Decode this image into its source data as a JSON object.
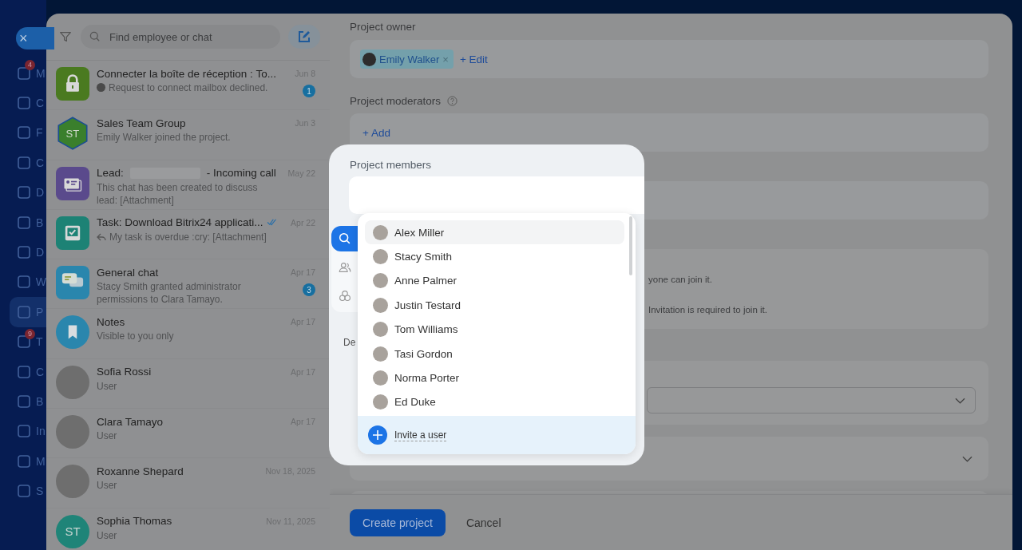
{
  "sidebar": {
    "close_label": "×",
    "items": [
      {
        "label": "M",
        "badge": "4",
        "selected": false
      },
      {
        "label": "C",
        "selected": false
      },
      {
        "label": "F",
        "selected": false
      },
      {
        "label": "C",
        "selected": false
      },
      {
        "label": "D",
        "selected": false
      },
      {
        "label": "B",
        "selected": false
      },
      {
        "label": "D",
        "selected": false
      },
      {
        "label": "W",
        "selected": false
      },
      {
        "label": "P",
        "selected": true
      },
      {
        "label": "T",
        "badge": "9",
        "selected": false
      },
      {
        "label": "C",
        "selected": false
      },
      {
        "label": "B",
        "selected": false
      },
      {
        "label": "In",
        "selected": false
      },
      {
        "label": "M",
        "selected": false
      },
      {
        "label": "S",
        "selected": false
      }
    ]
  },
  "chat_panel": {
    "search": {
      "placeholder": "Find employee or chat"
    },
    "chats": [
      {
        "kind": "lock",
        "title": "Connecter la boîte de réception : To...",
        "date": "Jun 8",
        "preview": "Request to connect mailbox declined.",
        "preview_avatar": true,
        "counter": "1"
      },
      {
        "kind": "group",
        "initials": "ST",
        "title": "Sales Team Group",
        "date": "Jun 3",
        "preview": "Emily Walker joined the project."
      },
      {
        "kind": "lead",
        "title": "Lead:",
        "redacted": true,
        "title_suffix": "- Incoming call",
        "date": "May 22",
        "preview": "This chat has been created to discuss lead: [Attachment]"
      },
      {
        "kind": "task",
        "title": "Task: Download Bitrix24 applicati...",
        "read": true,
        "date": "Apr 22",
        "preview": "My task is overdue :cry: [Attachment]",
        "reply": true
      },
      {
        "kind": "general",
        "title": "General chat",
        "date": "Apr 17",
        "preview": "Stacy Smith granted administrator permissions to Clara Tamayo.",
        "counter": "3"
      },
      {
        "kind": "notes",
        "title": "Notes",
        "date": "Apr 17",
        "preview": "Visible to you only"
      },
      {
        "kind": "photo",
        "title": "Sofia Rossi",
        "date": "Apr 17",
        "preview": "User"
      },
      {
        "kind": "photo",
        "title": "Clara Tamayo",
        "date": "Apr 17",
        "preview": "User"
      },
      {
        "kind": "photo",
        "title": "Roxanne Shepard",
        "date": "Nov 18, 2025",
        "preview": "User"
      },
      {
        "kind": "initials",
        "initials": "ST",
        "title": "Sophia Thomas",
        "date": "Nov 11, 2025",
        "preview": "User"
      }
    ]
  },
  "form": {
    "owner": {
      "label": "Project owner",
      "chip": "Emily Walker",
      "chip_remove": "×",
      "edit": "+ Edit"
    },
    "moderators": {
      "label": "Project moderators",
      "add": "+ Add"
    },
    "visibility_options": [
      "yone can join it.",
      "Invitation is required to join it."
    ],
    "section_label_fragment": "De"
  },
  "member_picker": {
    "label": "Project members",
    "tabs": [
      {
        "kind": "search",
        "selected": true
      },
      {
        "kind": "people",
        "selected": false
      },
      {
        "kind": "groups",
        "selected": false
      }
    ],
    "people": [
      {
        "name": "Alex Miller",
        "selected": true
      },
      {
        "name": "Stacy Smith",
        "selected": false
      },
      {
        "name": "Anne Palmer",
        "selected": false
      },
      {
        "name": "Justin Testard",
        "selected": false
      },
      {
        "name": "Tom Williams",
        "selected": false
      },
      {
        "name": "Tasi Gordon",
        "selected": false
      },
      {
        "name": "Norma Porter",
        "selected": false
      },
      {
        "name": "Ed Duke",
        "selected": false
      }
    ],
    "invite": "Invite a user"
  },
  "footer": {
    "primary": "Create project",
    "secondary": "Cancel"
  }
}
